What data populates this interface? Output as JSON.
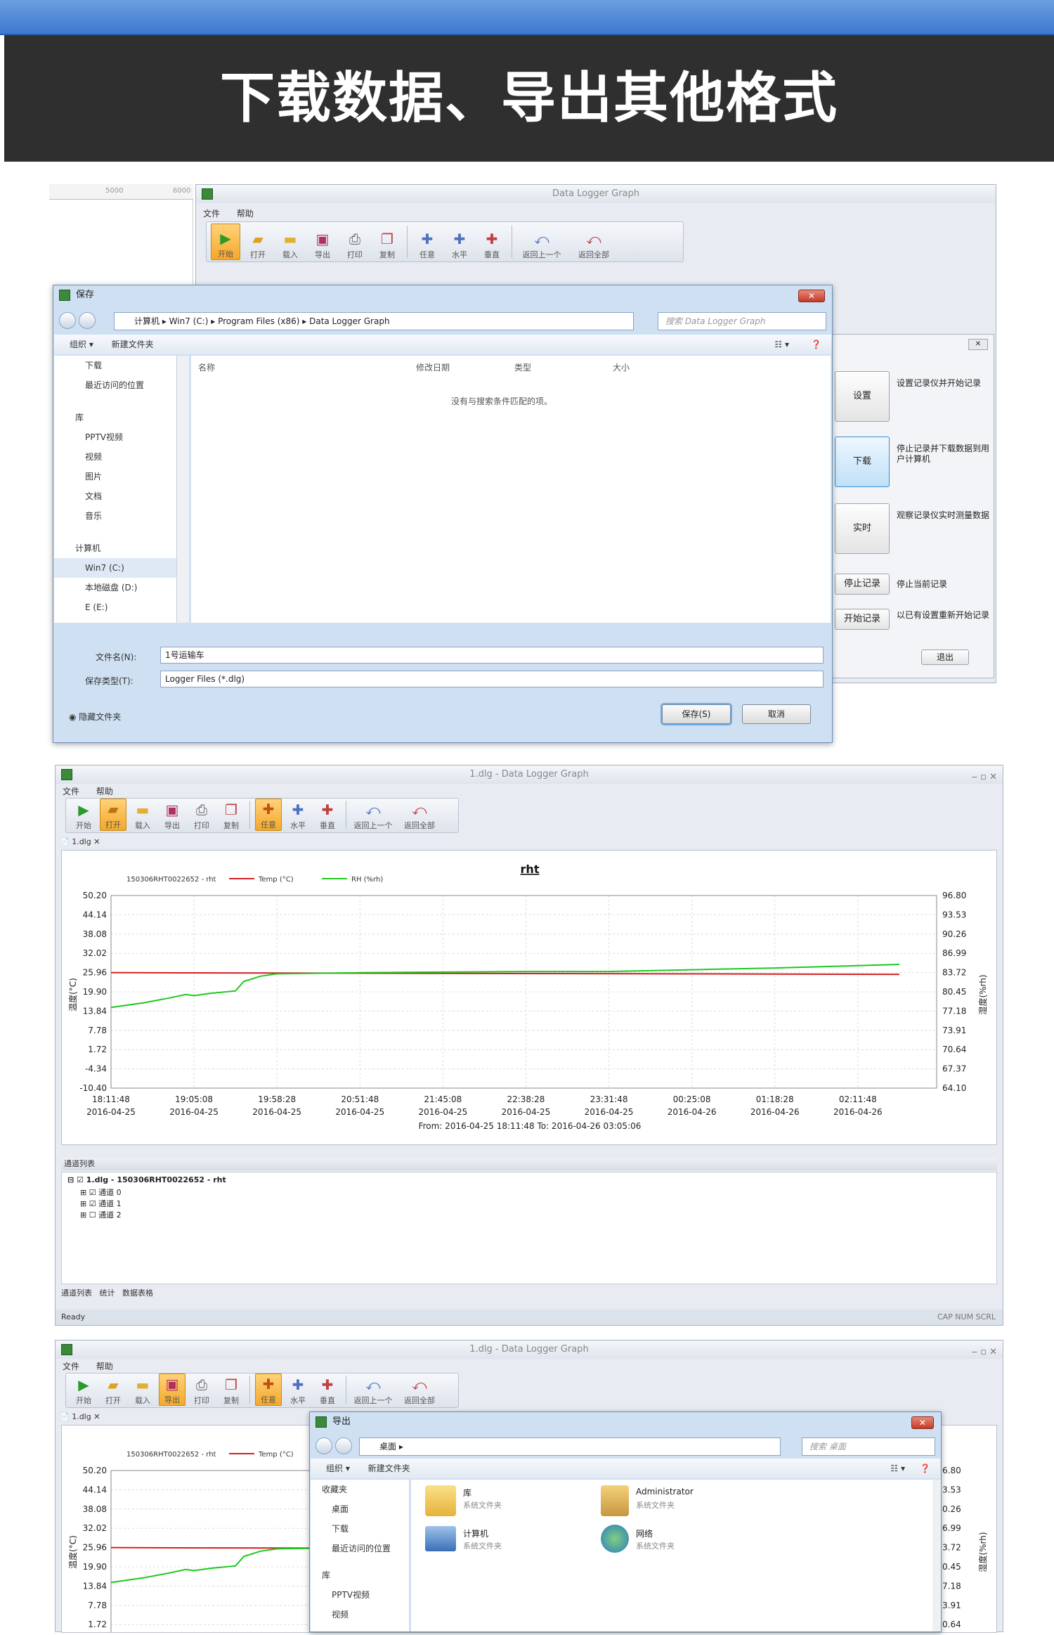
{
  "banner": {
    "title": "下载数据、导出其他格式"
  },
  "app": {
    "title": "Data Logger Graph",
    "doc_title": "1.dlg - Data Logger Graph",
    "menu": [
      "文件",
      "帮助"
    ],
    "toolbar": [
      "开始",
      "打开",
      "载入",
      "导出",
      "打印",
      "复制",
      "任意",
      "水平",
      "垂直",
      "返回上一个",
      "返回全部"
    ],
    "ruler": [
      "5000",
      "6000"
    ]
  },
  "save_dialog": {
    "title": "保存",
    "breadcrumb": [
      "计算机",
      "Win7 (C:)",
      "Program Files (x86)",
      "Data Logger Graph"
    ],
    "search_placeholder": "搜索 Data Logger Graph",
    "organize": "组织 ▾",
    "new_folder": "新建文件夹",
    "nav_items": [
      "下载",
      "最近访问的位置",
      "库",
      "PPTV视频",
      "视频",
      "图片",
      "文档",
      "音乐",
      "计算机",
      "Win7 (C:)",
      "本地磁盘 (D:)",
      "E (E:)"
    ],
    "columns": [
      "名称",
      "修改日期",
      "类型",
      "大小"
    ],
    "empty_text": "没有与搜索条件匹配的项。",
    "filename_label": "文件名(N):",
    "filename_value": "1号运输车",
    "filetype_label": "保存类型(T):",
    "filetype_value": "Logger Files (*.dlg)",
    "hide_folders": "隐藏文件夹",
    "save_button": "保存(S)",
    "cancel_button": "取消"
  },
  "side_panel": {
    "buttons": [
      {
        "label": "设置",
        "text": "设置记录仪并开始记录"
      },
      {
        "label": "下载",
        "text": "停止记录并下载数据到用户计算机"
      },
      {
        "label": "实时",
        "text": "观察记录仪实时测量数据"
      },
      {
        "label": "停止记录",
        "text": "停止当前记录"
      },
      {
        "label": "开始记录",
        "text": "以已有设置重新开始记录"
      }
    ],
    "exit": "退出"
  },
  "graph_window": {
    "tab": "1.dlg",
    "tree_header": "通道列表",
    "tree": [
      "1.dlg - 150306RHT0022652 - rht",
      "通道 0",
      "通道 1",
      "通道 2"
    ],
    "bottom_tabs": [
      "通道列表",
      "统计",
      "数据表格"
    ],
    "status": "Ready",
    "status_right": "CAP NUM SCRL"
  },
  "chart_data": {
    "type": "line",
    "title": "rht",
    "device": "150306RHT0022652 - rht",
    "legend": [
      "Temp (°C)",
      "RH (%rh)"
    ],
    "ylabel_left": "温度(°C)",
    "ylabel_right": "湿度(%rh)",
    "left_ticks": [
      "50.20",
      "44.14",
      "38.08",
      "32.02",
      "25.96",
      "19.90",
      "13.84",
      "7.78",
      "1.72",
      "-4.34",
      "-10.40"
    ],
    "right_ticks": [
      "96.80",
      "93.53",
      "90.26",
      "86.99",
      "83.72",
      "80.45",
      "77.18",
      "73.91",
      "70.64",
      "67.37",
      "64.10"
    ],
    "x_times": [
      "18:11:48",
      "19:05:08",
      "19:58:28",
      "20:51:48",
      "21:45:08",
      "22:38:28",
      "23:31:48",
      "00:25:08",
      "01:18:28",
      "02:11:48"
    ],
    "x_dates": [
      "2016-04-25",
      "2016-04-25",
      "2016-04-25",
      "2016-04-25",
      "2016-04-25",
      "2016-04-25",
      "2016-04-25",
      "2016-04-26",
      "2016-04-26",
      "2016-04-26"
    ],
    "range_text": "From: 2016-04-25 18:11:48  To: 2016-04-26 03:05:06",
    "ylim_left": [
      -10.4,
      50.2
    ],
    "ylim_right": [
      64.1,
      96.8
    ],
    "series": [
      {
        "name": "Temp (°C)",
        "axis": "left",
        "color": "#d42020",
        "x": [
          0,
          0.5,
          9.5
        ],
        "y": [
          25.96,
          25.9,
          25.4
        ]
      },
      {
        "name": "RH (%rh)",
        "axis": "right",
        "color": "#1ec81e",
        "x": [
          0,
          0.4,
          0.7,
          0.9,
          1.0,
          1.2,
          1.5,
          1.6,
          1.8,
          2.0,
          3.0,
          4.0,
          5.0,
          6.0,
          7.0,
          8.0,
          9.0,
          9.5
        ],
        "y": [
          77.8,
          78.6,
          79.4,
          80.0,
          79.8,
          80.2,
          80.6,
          82.2,
          83.1,
          83.5,
          83.7,
          83.8,
          83.9,
          83.9,
          84.2,
          84.5,
          84.9,
          85.1
        ]
      }
    ]
  },
  "export_dialog": {
    "title": "导出",
    "breadcrumb": [
      "桌面"
    ],
    "search_placeholder": "搜索 桌面",
    "organize": "组织 ▾",
    "new_folder": "新建文件夹",
    "nav_items": [
      "收藏夹",
      "桌面",
      "下载",
      "最近访问的位置",
      "库",
      "PPTV视频",
      "视频"
    ],
    "items": [
      {
        "name": "库",
        "type": "系统文件夹"
      },
      {
        "name": "Administrator",
        "type": "系统文件夹"
      },
      {
        "name": "计算机",
        "type": "系统文件夹"
      },
      {
        "name": "网络",
        "type": "系统文件夹"
      }
    ]
  },
  "graph2": {
    "legend": "Temp (°C)",
    "left_ticks": [
      "50.20",
      "44.14",
      "38.08",
      "32.02",
      "25.96",
      "19.90",
      "13.84",
      "7.78",
      "1.72"
    ],
    "right_ticks": [
      "6.80",
      "3.53",
      "0.26",
      "6.99",
      "3.72",
      "0.45",
      "7.18",
      "3.91",
      "0.64"
    ],
    "ylabel_right": "湿度(%rh)"
  }
}
